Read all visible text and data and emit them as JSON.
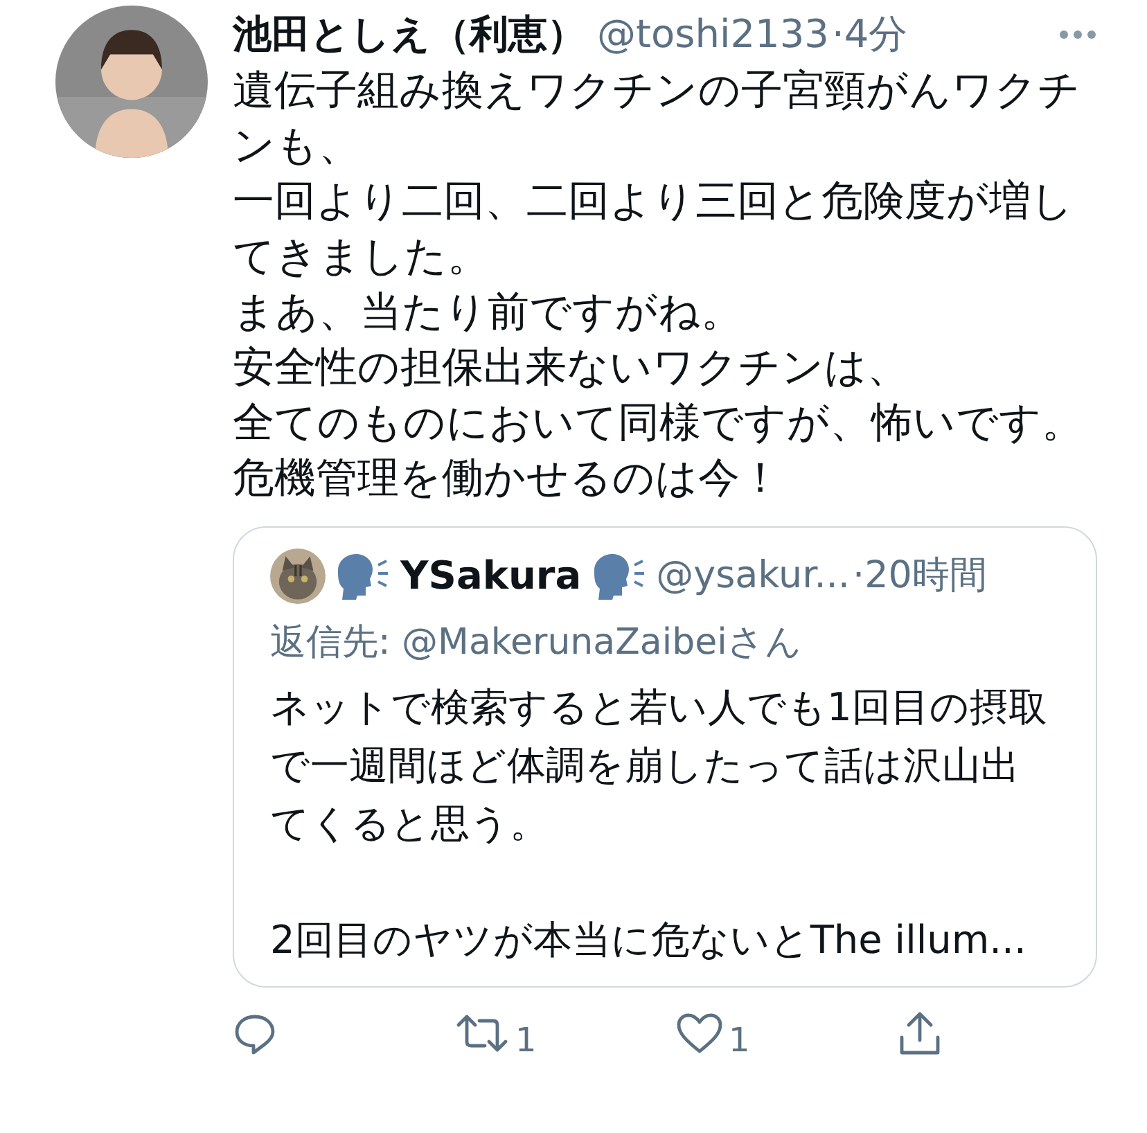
{
  "tweet": {
    "name": "池田としえ（利恵）",
    "handle": "@toshi2133",
    "time": "·4分",
    "lines": [
      "遺伝子組み換えワクチンの子宮頸がんワクチンも、",
      "一回より二回、二回より三回と危険度が増してきました。",
      "まあ、当たり前ですがね。",
      "安全性の担保出来ないワクチンは、",
      "全てのものにおいて同様ですが、怖いです。",
      "危機管理を働かせるのは今！"
    ]
  },
  "quote": {
    "name": "YSakura",
    "handle": "@ysakur...",
    "time": "·20時間",
    "reply_to": "返信先: @MakerunaZaibeiさん",
    "paragraphs": [
      "ネットで検索すると若い人でも1回目の摂取で一週間ほど体調を崩したって話は沢山出てくると思う。",
      "2回目のヤツが本当に危ないとThe illum..."
    ]
  },
  "actions": [
    {
      "kind": "reply"
    },
    {
      "kind": "retweet",
      "count": "1"
    },
    {
      "kind": "like",
      "count": "1"
    },
    {
      "kind": "share"
    }
  ]
}
